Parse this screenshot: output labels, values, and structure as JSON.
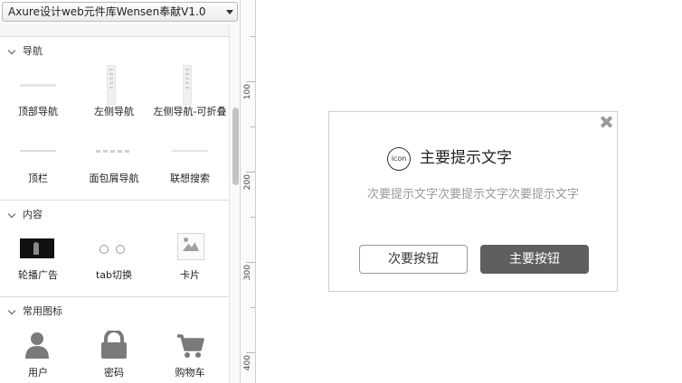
{
  "library": {
    "selected": "Axure设计web元件库Wensen奉献V1.0"
  },
  "sections": [
    {
      "title": "导航",
      "widgets": [
        {
          "label": "顶部导航",
          "icon": "top-nav-thumbnail"
        },
        {
          "label": "左侧导航",
          "icon": "left-nav-thumbnail"
        },
        {
          "label": "左侧导航-可折叠",
          "icon": "collapsible-left-nav-thumbnail"
        },
        {
          "label": "顶栏",
          "icon": "top-bar-thumbnail"
        },
        {
          "label": "面包屑导航",
          "icon": "breadcrumb-thumbnail"
        },
        {
          "label": "联想搜索",
          "icon": "autocomplete-search-thumbnail"
        }
      ]
    },
    {
      "title": "内容",
      "widgets": [
        {
          "label": "轮播广告",
          "icon": "carousel-thumbnail"
        },
        {
          "label": "tab切换",
          "icon": "tab-switch-thumbnail"
        },
        {
          "label": "卡片",
          "icon": "card-image-thumbnail"
        }
      ]
    },
    {
      "title": "常用图标",
      "widgets": [
        {
          "label": "用户",
          "icon": "user-icon"
        },
        {
          "label": "密码",
          "icon": "lock-icon"
        },
        {
          "label": "购物车",
          "icon": "shopping-cart-icon"
        }
      ]
    }
  ],
  "ruler": {
    "labels": [
      "100",
      "200",
      "300",
      "400"
    ]
  },
  "dialog": {
    "icon_text": "icon",
    "title": "主要提示文字",
    "subtitle": "次要提示文字次要提示文字次要提示文字",
    "secondary_button": "次要按钮",
    "primary_button": "主要按钮"
  },
  "colors": {
    "primary_button": "#5f5f5f",
    "muted_text": "#999999",
    "panel_border": "#d4d4d4"
  }
}
